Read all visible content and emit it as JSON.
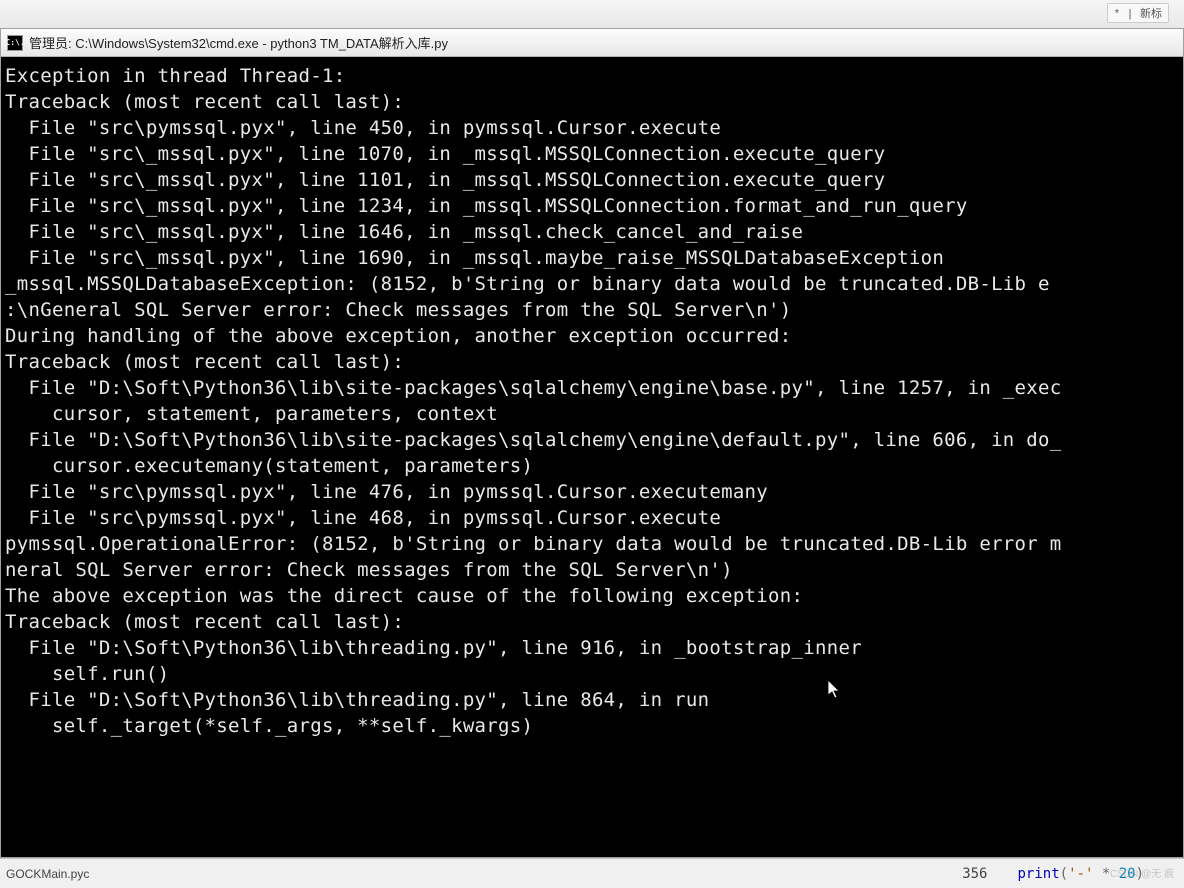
{
  "backdrop": {
    "hint": "",
    "new_tab": "* | 新标"
  },
  "window": {
    "icon_label": "C:\\.",
    "title": "管理员: C:\\Windows\\System32\\cmd.exe - python3  TM_DATA解析入库.py"
  },
  "terminal_lines": [
    "Exception in thread Thread-1:",
    "Traceback (most recent call last):",
    "  File \"src\\pymssql.pyx\", line 450, in pymssql.Cursor.execute",
    "  File \"src\\_mssql.pyx\", line 1070, in _mssql.MSSQLConnection.execute_query",
    "  File \"src\\_mssql.pyx\", line 1101, in _mssql.MSSQLConnection.execute_query",
    "  File \"src\\_mssql.pyx\", line 1234, in _mssql.MSSQLConnection.format_and_run_query",
    "  File \"src\\_mssql.pyx\", line 1646, in _mssql.check_cancel_and_raise",
    "  File \"src\\_mssql.pyx\", line 1690, in _mssql.maybe_raise_MSSQLDatabaseException",
    "_mssql.MSSQLDatabaseException: (8152, b'String or binary data would be truncated.DB-Lib e",
    ":\\nGeneral SQL Server error: Check messages from the SQL Server\\n')",
    "",
    "During handling of the above exception, another exception occurred:",
    "",
    "Traceback (most recent call last):",
    "  File \"D:\\Soft\\Python36\\lib\\site-packages\\sqlalchemy\\engine\\base.py\", line 1257, in _exec",
    "    cursor, statement, parameters, context",
    "  File \"D:\\Soft\\Python36\\lib\\site-packages\\sqlalchemy\\engine\\default.py\", line 606, in do_",
    "    cursor.executemany(statement, parameters)",
    "  File \"src\\pymssql.pyx\", line 476, in pymssql.Cursor.executemany",
    "  File \"src\\pymssql.pyx\", line 468, in pymssql.Cursor.execute",
    "pymssql.OperationalError: (8152, b'String or binary data would be truncated.DB-Lib error m",
    "neral SQL Server error: Check messages from the SQL Server\\n')",
    "",
    "The above exception was the direct cause of the following exception:",
    "",
    "Traceback (most recent call last):",
    "  File \"D:\\Soft\\Python36\\lib\\threading.py\", line 916, in _bootstrap_inner",
    "    self.run()",
    "  File \"D:\\Soft\\Python36\\lib\\threading.py\", line 864, in run",
    "    self._target(*self._args, **self._kwargs)"
  ],
  "bottom": {
    "left_file": "GOCKMain.pyc",
    "line_num": "356",
    "code_full": "print('-' * 20)"
  },
  "watermark": "CSDN @无 痕"
}
